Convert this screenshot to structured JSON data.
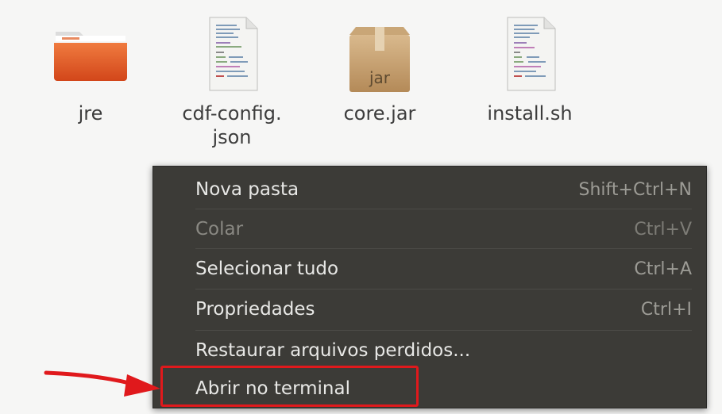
{
  "files": [
    {
      "name": "jre",
      "icon": "folder-icon",
      "color": "#e35e1f"
    },
    {
      "name": "cdf-config.\njson",
      "icon": "text-file-icon"
    },
    {
      "name": "core.jar",
      "icon": "jar-package-icon",
      "icon_text": "jar"
    },
    {
      "name": "install.sh",
      "icon": "script-file-icon"
    }
  ],
  "context_menu": {
    "items": [
      {
        "label": "Nova pasta",
        "shortcut": "Shift+Ctrl+N",
        "enabled": true
      },
      {
        "label": "Colar",
        "shortcut": "Ctrl+V",
        "enabled": false
      },
      {
        "label": "Selecionar tudo",
        "shortcut": "Ctrl+A",
        "enabled": true
      },
      {
        "label": "Propriedades",
        "shortcut": "Ctrl+I",
        "enabled": true
      },
      {
        "label": "Restaurar arquivos perdidos...",
        "shortcut": "",
        "enabled": true
      },
      {
        "label": "Abrir no terminal",
        "shortcut": "",
        "enabled": true,
        "highlighted": true
      }
    ]
  },
  "colors": {
    "menu_background": "#3c3b37",
    "menu_text": "#e8e8e6",
    "annotation_red": "#e0191c",
    "folder_orange": "#e35e1f"
  }
}
